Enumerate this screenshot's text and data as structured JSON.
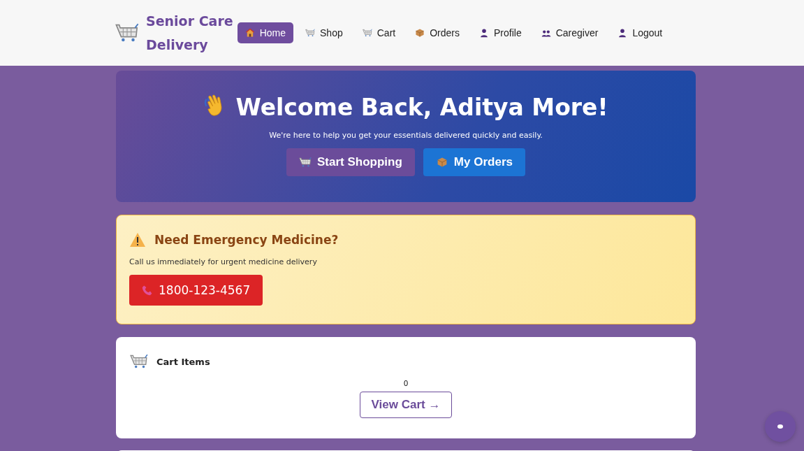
{
  "brand": {
    "line1": "Senior Care",
    "line2": "Delivery"
  },
  "nav": [
    {
      "label": "Home",
      "selected": true
    },
    {
      "label": "Shop",
      "selected": false
    },
    {
      "label": "Cart",
      "selected": false
    },
    {
      "label": "Orders",
      "selected": false
    },
    {
      "label": "Profile",
      "selected": false
    },
    {
      "label": "Caregiver",
      "selected": false
    },
    {
      "label": "Logout",
      "selected": false
    }
  ],
  "hero": {
    "title": "Welcome Back, Aditya More!",
    "subtitle": "We're here to help you get your essentials delivered quickly and easily.",
    "buttons": [
      {
        "kind": "shop",
        "label": "Start Shopping"
      },
      {
        "kind": "orders",
        "label": "My Orders"
      }
    ]
  },
  "emergency": {
    "title": "Need Emergency Medicine?",
    "text": "Call us immediately for urgent medicine delivery",
    "phone": "1800-123-4567"
  },
  "cart_card": {
    "title": "Cart Items",
    "count": "0",
    "button": "View Cart →"
  }
}
